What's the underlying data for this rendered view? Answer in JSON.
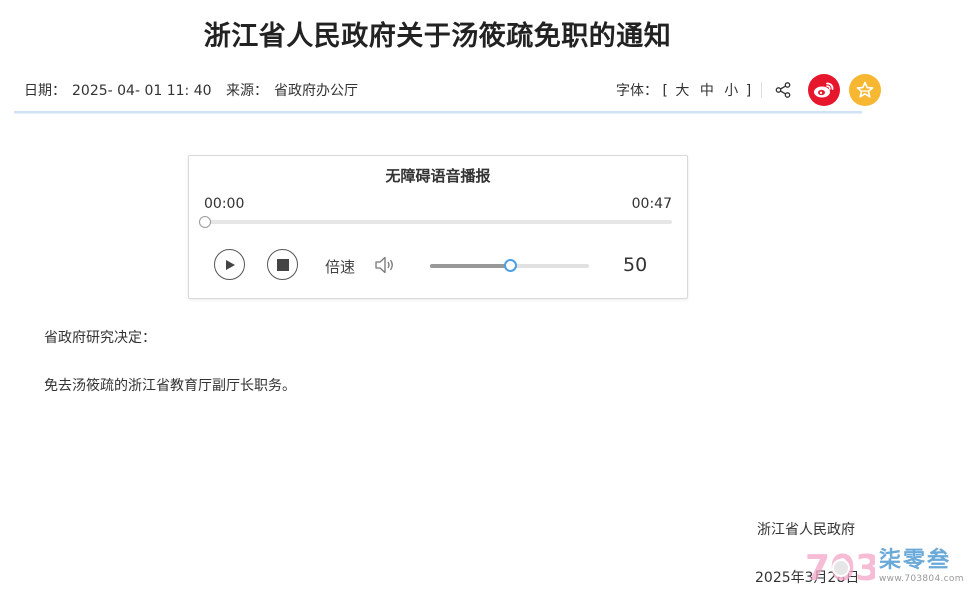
{
  "article": {
    "title": "浙江省人民政府关于汤筱疏免职的通知",
    "date_label": "日期：",
    "date_value": "2025- 04- 01 11: 40",
    "source_label": "来源：",
    "source_value": "省政府办公厅",
    "paragraphs": [
      "省政府研究决定：",
      "免去汤筱疏的浙江省教育厅副厅长职务。"
    ],
    "signature": "浙江省人民政府",
    "sign_date": "2025年3月28日"
  },
  "toolbar": {
    "font_label": "字体：",
    "bracket_open": "[",
    "bracket_close": "]",
    "sizes": [
      "大",
      "中",
      "小"
    ],
    "share_icon": "share-icon",
    "weibo_icon": "weibo-icon",
    "favorite_icon": "star-icon",
    "weibo_color": "#e6162d",
    "favorite_color": "#f7b731"
  },
  "player": {
    "title": "无障碍语音播报",
    "current_time": "00:00",
    "total_time": "00:47",
    "progress": 0,
    "speed_label": "倍速",
    "volume_value": "50",
    "volume_fraction": 0.5,
    "accent_color": "#4a9fe6"
  },
  "watermark": {
    "logo_text": "703",
    "brand": "柒零叁",
    "url": "www.703804.com"
  }
}
